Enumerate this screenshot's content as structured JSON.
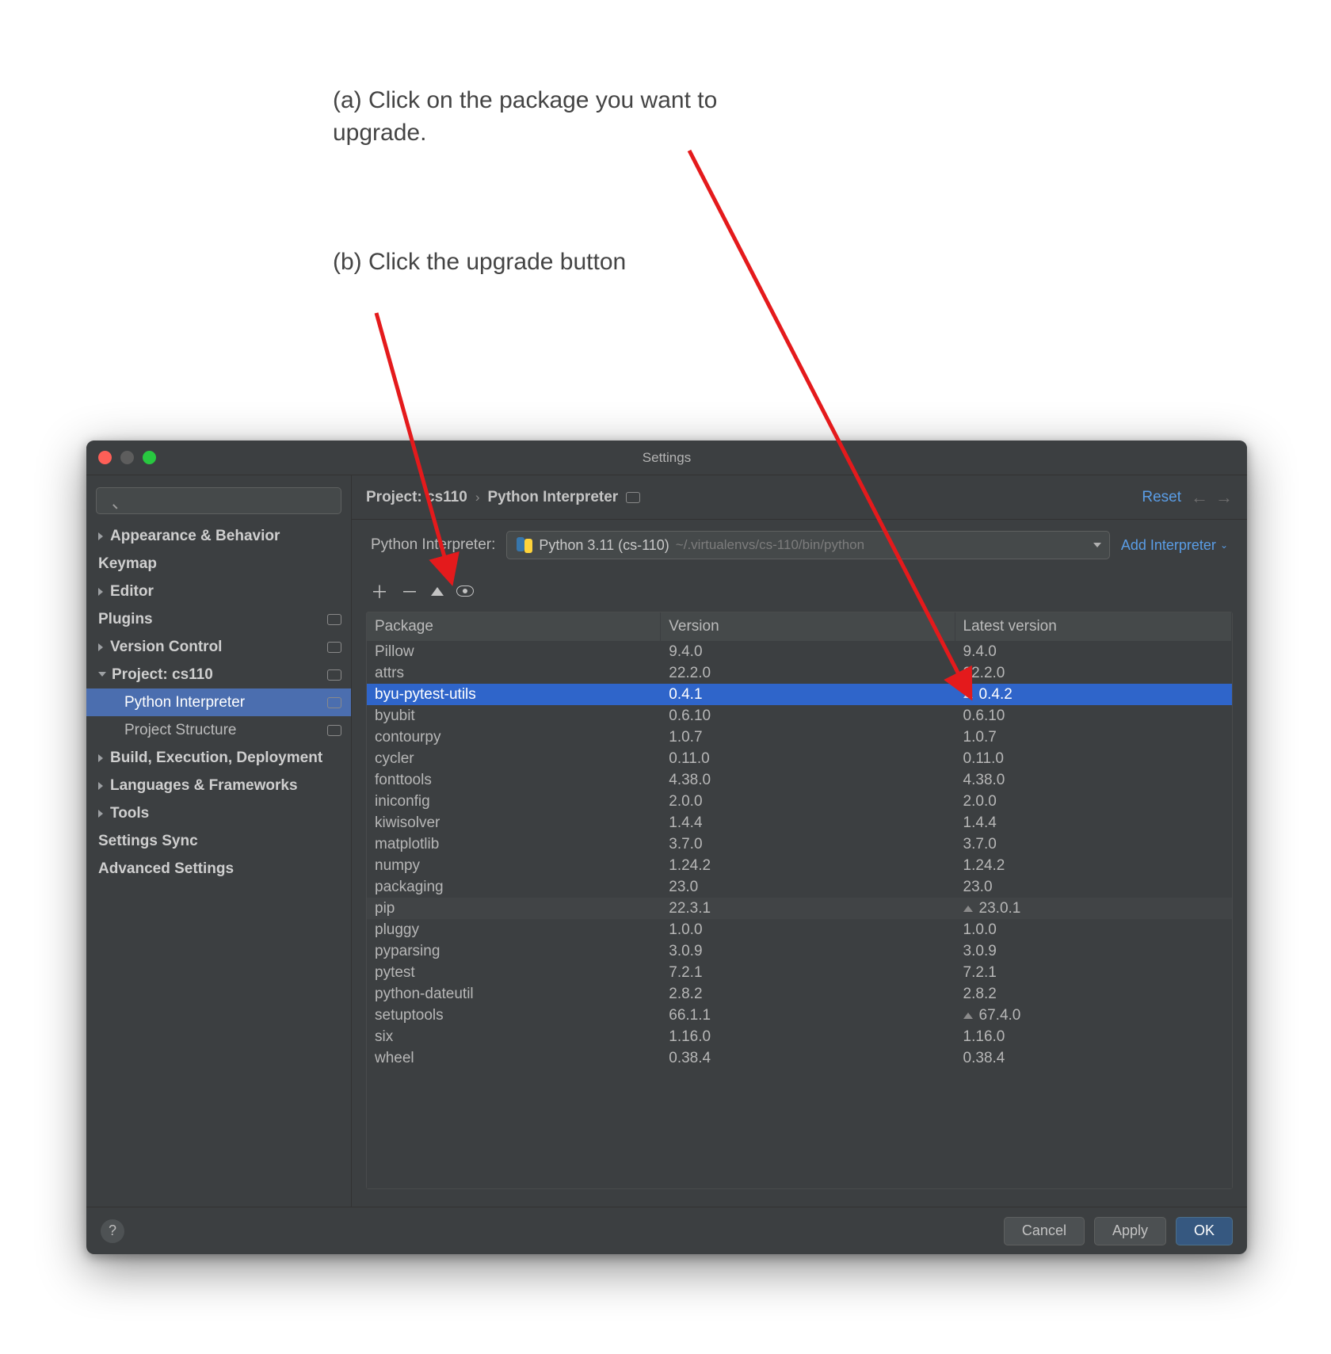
{
  "annotation_a": "(a) Click on the package you want to upgrade.",
  "annotation_b": "(b) Click the upgrade button",
  "window": {
    "title": "Settings",
    "search_placeholder": ""
  },
  "sidebar": {
    "items": [
      {
        "label": "Appearance & Behavior",
        "bold": true,
        "type": "collapsed",
        "badge": false
      },
      {
        "label": "Keymap",
        "bold": true,
        "type": "none",
        "badge": false
      },
      {
        "label": "Editor",
        "bold": true,
        "type": "collapsed",
        "badge": false
      },
      {
        "label": "Plugins",
        "bold": true,
        "type": "none",
        "badge": true
      },
      {
        "label": "Version Control",
        "bold": true,
        "type": "collapsed",
        "badge": true
      },
      {
        "label": "Project: cs110",
        "bold": true,
        "type": "expanded",
        "badge": true
      },
      {
        "label": "Python Interpreter",
        "bold": false,
        "type": "child",
        "badge": true,
        "selected": true
      },
      {
        "label": "Project Structure",
        "bold": false,
        "type": "child",
        "badge": true
      },
      {
        "label": "Build, Execution, Deployment",
        "bold": true,
        "type": "collapsed",
        "badge": false
      },
      {
        "label": "Languages & Frameworks",
        "bold": true,
        "type": "collapsed",
        "badge": false
      },
      {
        "label": "Tools",
        "bold": true,
        "type": "collapsed",
        "badge": false
      },
      {
        "label": "Settings Sync",
        "bold": true,
        "type": "none",
        "badge": false
      },
      {
        "label": "Advanced Settings",
        "bold": true,
        "type": "none",
        "badge": false
      }
    ]
  },
  "crumbs": {
    "project": "Project: cs110",
    "page": "Python Interpreter",
    "reset": "Reset"
  },
  "interpreter": {
    "label": "Python Interpreter:",
    "name": "Python 3.11 (cs-110)",
    "path": "~/.virtualenvs/cs-110/bin/python",
    "add_link": "Add Interpreter"
  },
  "table": {
    "headers": {
      "pkg": "Package",
      "ver": "Version",
      "latest": "Latest version"
    },
    "rows": [
      {
        "name": "Pillow",
        "ver": "9.4.0",
        "latest": "9.4.0",
        "upgradable": false
      },
      {
        "name": "attrs",
        "ver": "22.2.0",
        "latest": "22.2.0",
        "upgradable": false
      },
      {
        "name": "byu-pytest-utils",
        "ver": "0.4.1",
        "latest": "0.4.2",
        "upgradable": true,
        "selected": true
      },
      {
        "name": "byubit",
        "ver": "0.6.10",
        "latest": "0.6.10",
        "upgradable": false
      },
      {
        "name": "contourpy",
        "ver": "1.0.7",
        "latest": "1.0.7",
        "upgradable": false
      },
      {
        "name": "cycler",
        "ver": "0.11.0",
        "latest": "0.11.0",
        "upgradable": false
      },
      {
        "name": "fonttools",
        "ver": "4.38.0",
        "latest": "4.38.0",
        "upgradable": false
      },
      {
        "name": "iniconfig",
        "ver": "2.0.0",
        "latest": "2.0.0",
        "upgradable": false
      },
      {
        "name": "kiwisolver",
        "ver": "1.4.4",
        "latest": "1.4.4",
        "upgradable": false
      },
      {
        "name": "matplotlib",
        "ver": "3.7.0",
        "latest": "3.7.0",
        "upgradable": false
      },
      {
        "name": "numpy",
        "ver": "1.24.2",
        "latest": "1.24.2",
        "upgradable": false
      },
      {
        "name": "packaging",
        "ver": "23.0",
        "latest": "23.0",
        "upgradable": false
      },
      {
        "name": "pip",
        "ver": "22.3.1",
        "latest": "23.0.1",
        "upgradable": true,
        "alt": true
      },
      {
        "name": "pluggy",
        "ver": "1.0.0",
        "latest": "1.0.0",
        "upgradable": false
      },
      {
        "name": "pyparsing",
        "ver": "3.0.9",
        "latest": "3.0.9",
        "upgradable": false
      },
      {
        "name": "pytest",
        "ver": "7.2.1",
        "latest": "7.2.1",
        "upgradable": false
      },
      {
        "name": "python-dateutil",
        "ver": "2.8.2",
        "latest": "2.8.2",
        "upgradable": false
      },
      {
        "name": "setuptools",
        "ver": "66.1.1",
        "latest": "67.4.0",
        "upgradable": true
      },
      {
        "name": "six",
        "ver": "1.16.0",
        "latest": "1.16.0",
        "upgradable": false
      },
      {
        "name": "wheel",
        "ver": "0.38.4",
        "latest": "0.38.4",
        "upgradable": false
      }
    ]
  },
  "buttons": {
    "cancel": "Cancel",
    "apply": "Apply",
    "ok": "OK",
    "help": "?"
  }
}
